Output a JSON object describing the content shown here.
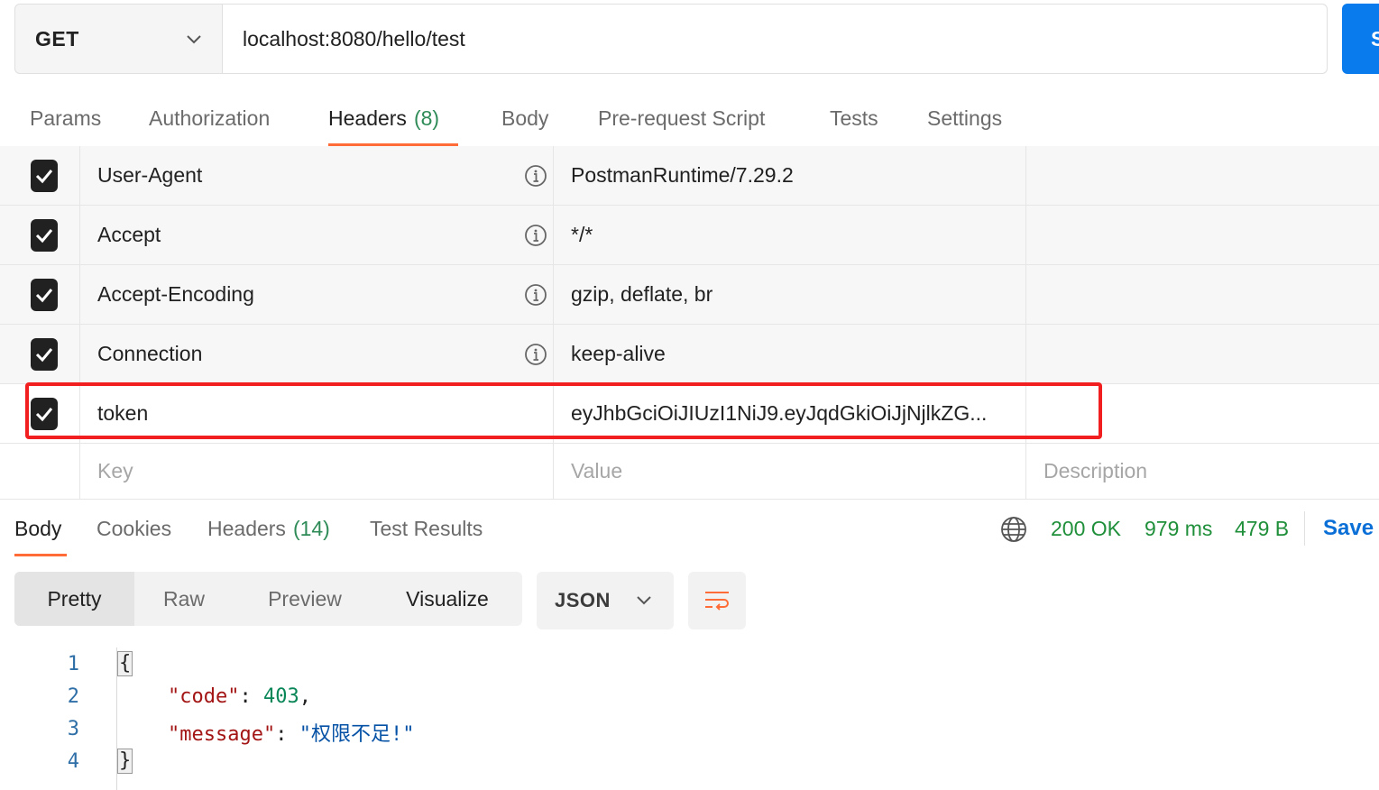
{
  "request": {
    "method": "GET",
    "url": "localhost:8080/hello/test",
    "send_label": "S"
  },
  "request_tabs": [
    {
      "label": "Params"
    },
    {
      "label": "Authorization"
    },
    {
      "label": "Headers",
      "count": "(8)"
    },
    {
      "label": "Body"
    },
    {
      "label": "Pre-request Script"
    },
    {
      "label": "Tests"
    },
    {
      "label": "Settings"
    }
  ],
  "headers": [
    {
      "key": "User-Agent",
      "value": "PostmanRuntime/7.29.2",
      "checked": true
    },
    {
      "key": "Accept",
      "value": "*/*",
      "checked": true
    },
    {
      "key": "Accept-Encoding",
      "value": "gzip, deflate, br",
      "checked": true
    },
    {
      "key": "Connection",
      "value": "keep-alive",
      "checked": true
    },
    {
      "key": "token",
      "value": "eyJhbGciOiJIUzI1NiJ9.eyJqdGkiOiJjNjlkZG...",
      "checked": true
    }
  ],
  "placeholders": {
    "key": "Key",
    "value": "Value",
    "description": "Description"
  },
  "response_tabs": [
    {
      "label": "Body"
    },
    {
      "label": "Cookies"
    },
    {
      "label": "Headers",
      "count": "(14)"
    },
    {
      "label": "Test Results"
    }
  ],
  "response_status": {
    "status": "200 OK",
    "time": "979 ms",
    "size": "479 B",
    "save_label": "Save"
  },
  "view_modes": [
    "Pretty",
    "Raw",
    "Preview",
    "Visualize"
  ],
  "format": "JSON",
  "code_lines": [
    {
      "num": "1",
      "text": "{"
    },
    {
      "num": "2",
      "key": "\"code\"",
      "value": "403"
    },
    {
      "num": "3",
      "key": "\"message\"",
      "value": "\"权限不足!\""
    },
    {
      "num": "4",
      "text": "}"
    }
  ],
  "colors": {
    "accent": "#ff6c37",
    "send": "#097bed",
    "status_ok": "#1f8f3a",
    "highlight": "#f11f1f"
  }
}
